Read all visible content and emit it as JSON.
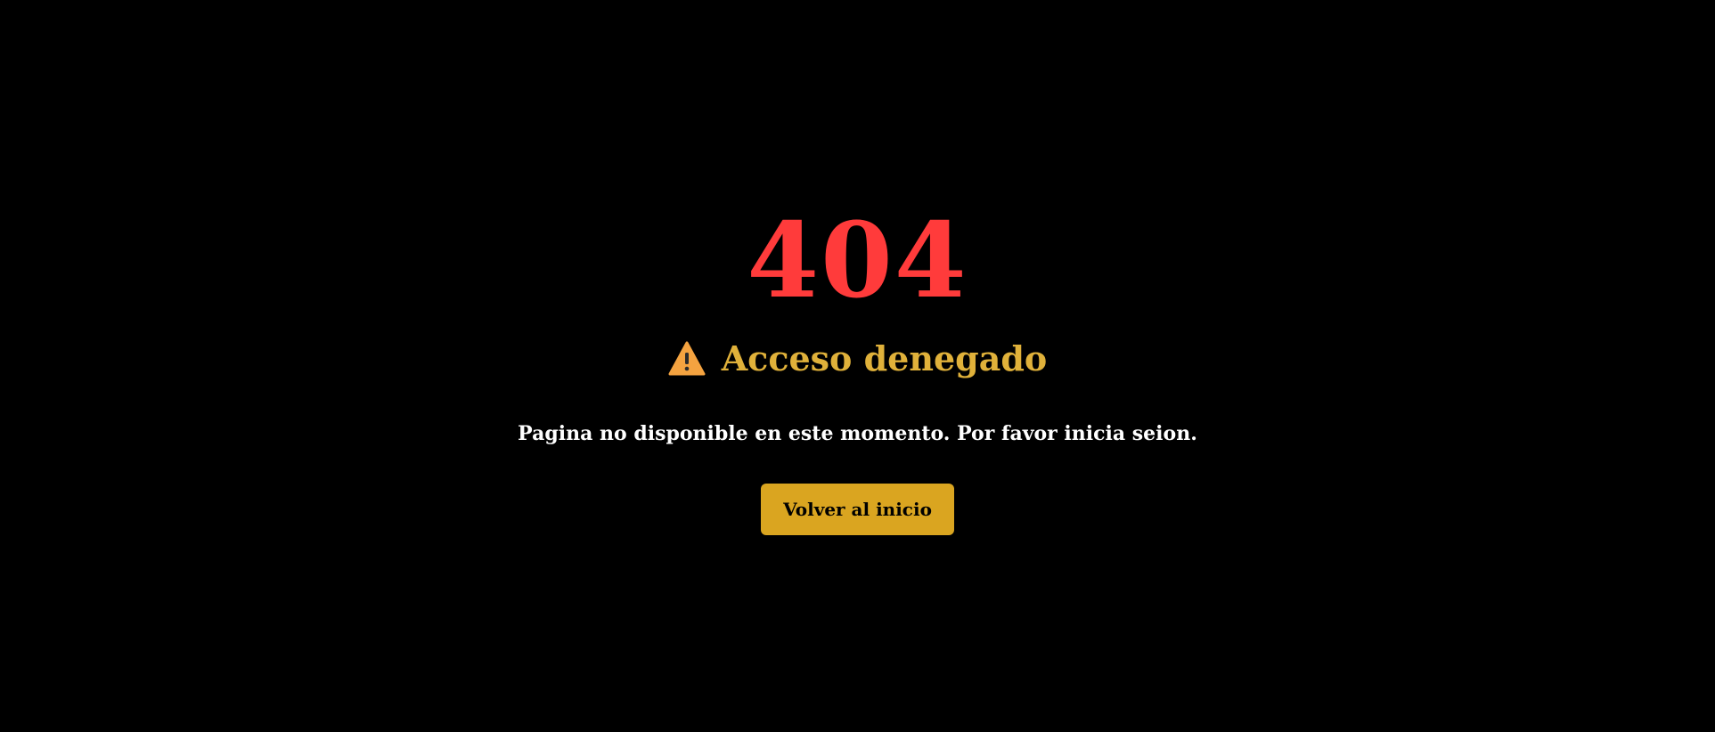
{
  "error": {
    "code": "404",
    "title": "Acceso denegado",
    "icon": "warning-icon",
    "message": "Pagina no disponible en este momento. Por favor inicia seion."
  },
  "actions": {
    "home_label": "Volver al inicio"
  },
  "colors": {
    "background": "#000000",
    "code": "#ff3b3b",
    "title": "#e0b13a",
    "message": "#ffffff",
    "button_bg": "#daa520",
    "button_text": "#000000",
    "icon_fill": "#f4a340"
  }
}
